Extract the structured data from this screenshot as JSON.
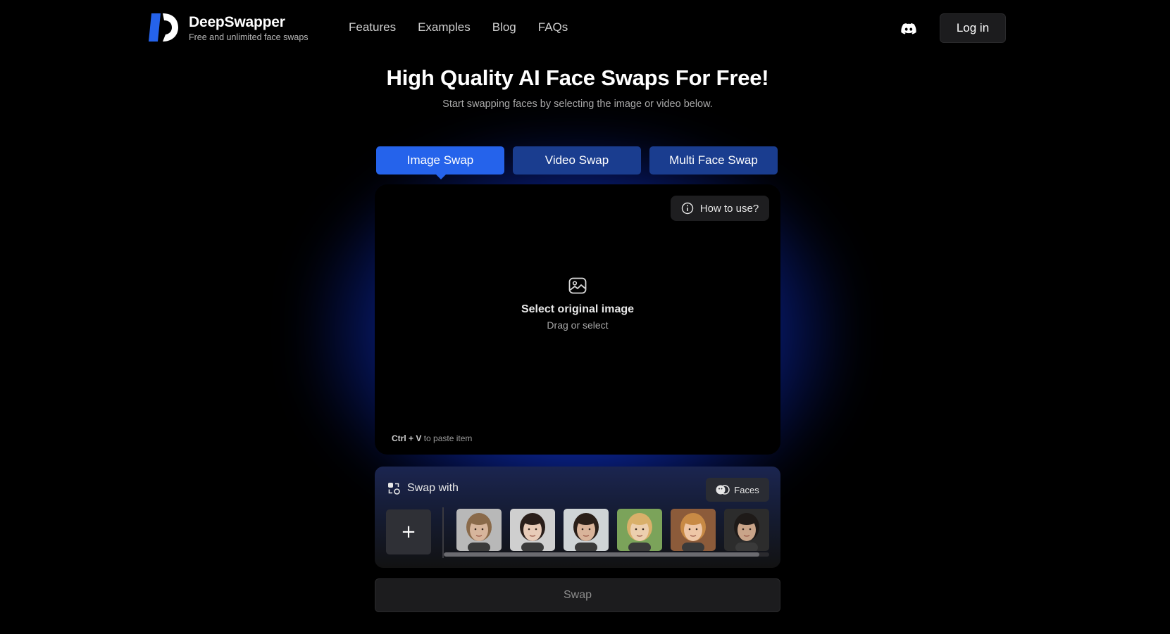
{
  "brand": {
    "name": "DeepSwapper",
    "tagline": "Free and unlimited face swaps"
  },
  "nav": {
    "items": [
      "Features",
      "Examples",
      "Blog",
      "FAQs"
    ],
    "login_label": "Log in"
  },
  "hero": {
    "title": "High Quality AI Face Swaps For Free!",
    "subtitle": "Start swapping faces by selecting the image or video below."
  },
  "tabs": [
    {
      "label": "Image Swap",
      "active": true
    },
    {
      "label": "Video Swap",
      "active": false
    },
    {
      "label": "Multi Face Swap",
      "active": false
    }
  ],
  "upload": {
    "howto_label": "How to use?",
    "title": "Select original image",
    "subtitle": "Drag or select",
    "paste_keys": "Ctrl + V",
    "paste_text": "to paste item"
  },
  "swap_with": {
    "label": "Swap with",
    "faces_label": "Faces",
    "add_label": "+",
    "faces": [
      {
        "skin": "#d7b59c",
        "hair": "#8a6a4a",
        "bg": "#b8b8b8"
      },
      {
        "skin": "#e8cbb8",
        "hair": "#2a1e1a",
        "bg": "#cfcfcf"
      },
      {
        "skin": "#d9b49a",
        "hair": "#2a1f18",
        "bg": "#cfd4d6"
      },
      {
        "skin": "#eccfae",
        "hair": "#d9b06a",
        "bg": "#7ba35a"
      },
      {
        "skin": "#eec6a6",
        "hair": "#c88a45",
        "bg": "#8c5b3a"
      },
      {
        "skin": "#c9a489",
        "hair": "#1e1a18",
        "bg": "#2c2c2c"
      }
    ]
  },
  "swap_button_label": "Swap",
  "colors": {
    "accent": "#2563eb",
    "tab_inactive": "#1a3d8f",
    "glow": "#1446ff"
  }
}
